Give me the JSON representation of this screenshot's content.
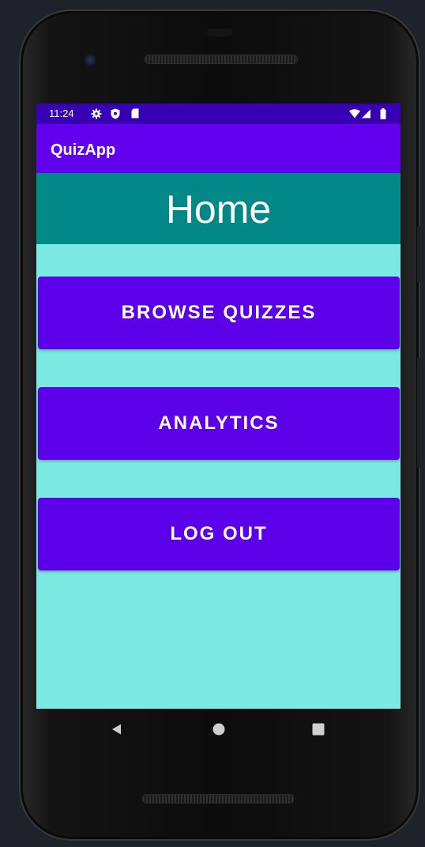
{
  "status_bar": {
    "time": "11:24",
    "icons": [
      "gear-icon",
      "shield-icon",
      "sd-card-icon",
      "wifi-icon",
      "signal-icon",
      "battery-icon"
    ]
  },
  "app_bar": {
    "title": "QuizApp"
  },
  "header": {
    "title": "Home"
  },
  "menu": {
    "buttons": [
      {
        "label": "BROWSE QUIZZES"
      },
      {
        "label": "ANALYTICS"
      },
      {
        "label": "LOG OUT"
      }
    ]
  },
  "nav_bar": {
    "buttons": [
      "back-icon",
      "home-icon",
      "recents-icon"
    ]
  },
  "colors": {
    "status_bar": "#3700b3",
    "app_bar": "#6200ee",
    "header_band": "#028886",
    "content_background": "#7de9e3",
    "button": "#5c00ea"
  }
}
